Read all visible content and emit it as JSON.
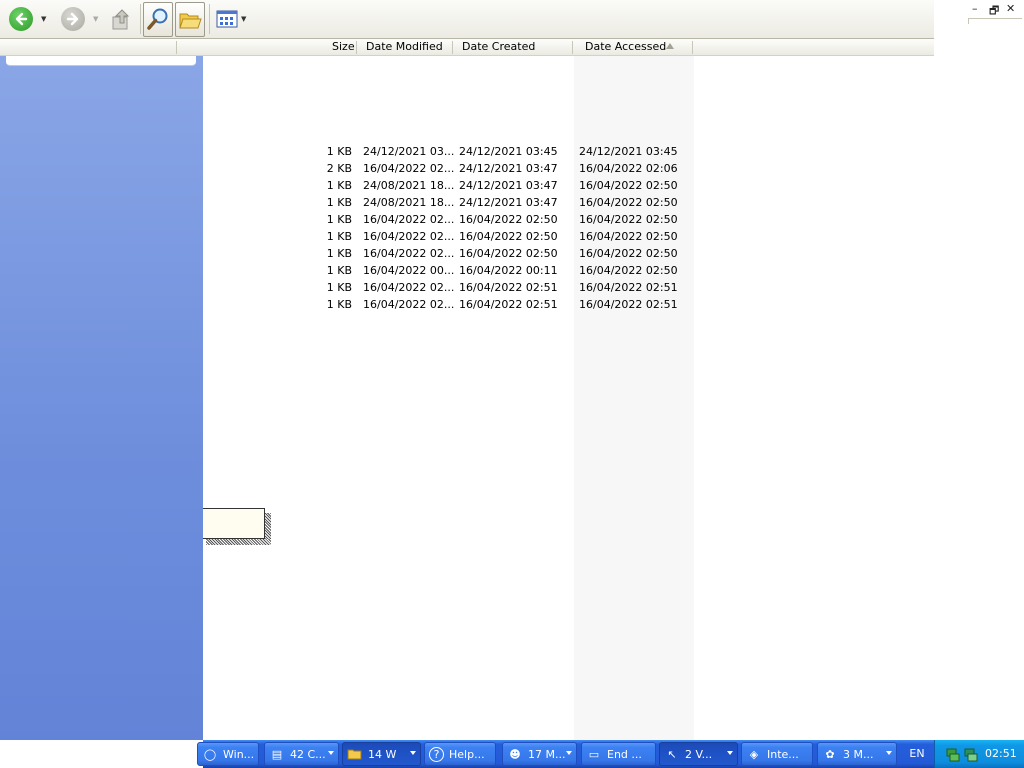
{
  "window_controls": {
    "minimize": "–",
    "restore": "🗗",
    "close": "✕"
  },
  "columns": [
    {
      "label": "Size"
    },
    {
      "label": "Date Modified"
    },
    {
      "label": "Date Created"
    },
    {
      "label": "Date Accessed"
    }
  ],
  "sorted_column": "Date Accessed",
  "rows": [
    {
      "size": "1 KB",
      "modified": "24/12/2021 03...",
      "created": "24/12/2021 03:45",
      "accessed": "24/12/2021 03:45"
    },
    {
      "size": "2 KB",
      "modified": "16/04/2022 02...",
      "created": "24/12/2021 03:47",
      "accessed": "16/04/2022 02:06"
    },
    {
      "size": "1 KB",
      "modified": "24/08/2021 18...",
      "created": "24/12/2021 03:47",
      "accessed": "16/04/2022 02:50"
    },
    {
      "size": "1 KB",
      "modified": "24/08/2021 18...",
      "created": "24/12/2021 03:47",
      "accessed": "16/04/2022 02:50"
    },
    {
      "size": "1 KB",
      "modified": "16/04/2022 02...",
      "created": "16/04/2022 02:50",
      "accessed": "16/04/2022 02:50"
    },
    {
      "size": "1 KB",
      "modified": "16/04/2022 02...",
      "created": "16/04/2022 02:50",
      "accessed": "16/04/2022 02:50"
    },
    {
      "size": "1 KB",
      "modified": "16/04/2022 02...",
      "created": "16/04/2022 02:50",
      "accessed": "16/04/2022 02:50"
    },
    {
      "size": "1 KB",
      "modified": "16/04/2022 00...",
      "created": "16/04/2022 00:11",
      "accessed": "16/04/2022 02:50"
    },
    {
      "size": "1 KB",
      "modified": "16/04/2022 02...",
      "created": "16/04/2022 02:51",
      "accessed": "16/04/2022 02:51"
    },
    {
      "size": "1 KB",
      "modified": "16/04/2022 02...",
      "created": "16/04/2022 02:51",
      "accessed": "16/04/2022 02:51"
    }
  ],
  "taskbar": {
    "tasks": [
      {
        "label": "Win...",
        "icon": "windows-icon",
        "group": false,
        "active": false
      },
      {
        "label": "42 C...",
        "icon": "notepad-icon",
        "group": true,
        "active": false
      },
      {
        "label": "14 W",
        "icon": "folder-icon",
        "group": true,
        "active": true
      },
      {
        "label": "Help...",
        "icon": "help-icon",
        "group": false,
        "active": false
      },
      {
        "label": "17 M...",
        "icon": "raccoon-icon",
        "group": true,
        "active": false
      },
      {
        "label": "End ...",
        "icon": "window-icon",
        "group": false,
        "active": false
      },
      {
        "label": "2 V...",
        "icon": "cursor-icon",
        "group": true,
        "active": true
      },
      {
        "label": "Inte...",
        "icon": "network-icon",
        "group": false,
        "active": false
      },
      {
        "label": "3 M...",
        "icon": "app-icon",
        "group": true,
        "active": false
      }
    ],
    "language": "EN",
    "clock": "02:51"
  },
  "colors": {
    "taskbar": "#245edb",
    "tray": "#0f97e6",
    "task_pane": "#6d8ddc",
    "sorted_column_bg": "#f7f7f7"
  }
}
